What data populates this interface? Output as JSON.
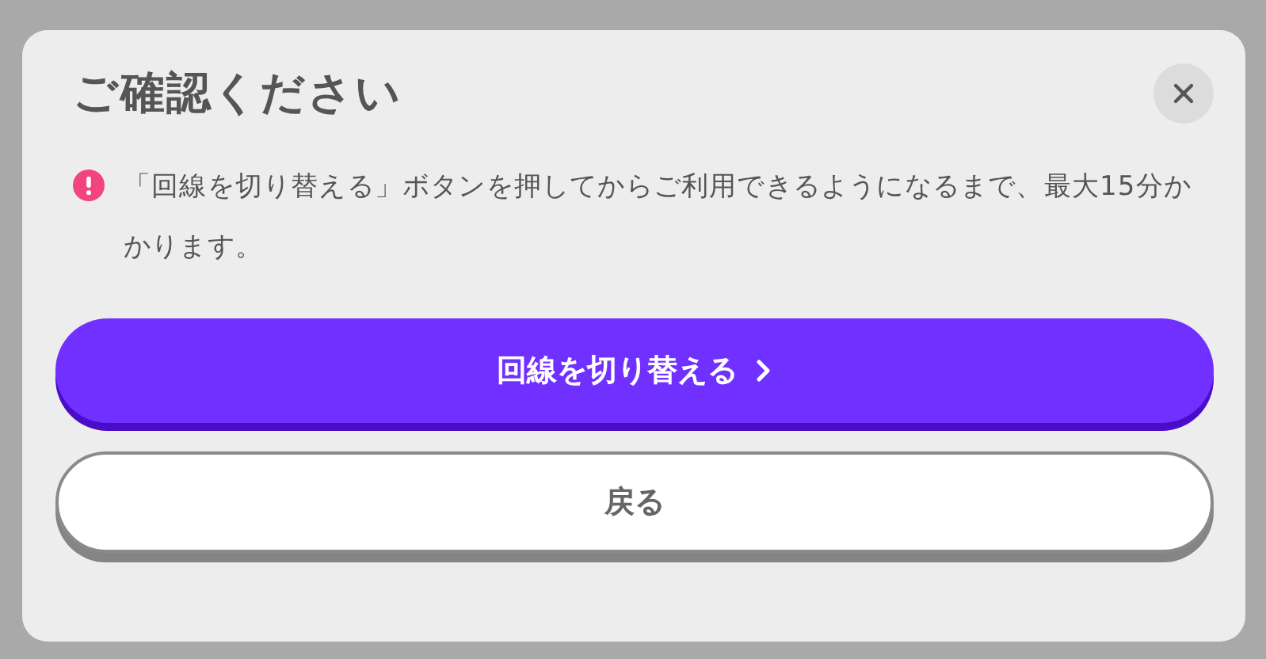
{
  "dialog": {
    "title": "ご確認ください",
    "notice": {
      "kind": "alert",
      "text": "「回線を切り替える」ボタンを押してからご利用できるようになるまで、最大15分かかります。"
    },
    "buttons": [
      {
        "label": "回線を切り替える",
        "kind": "primary"
      },
      {
        "label": "戻る",
        "kind": "secondary"
      }
    ]
  }
}
